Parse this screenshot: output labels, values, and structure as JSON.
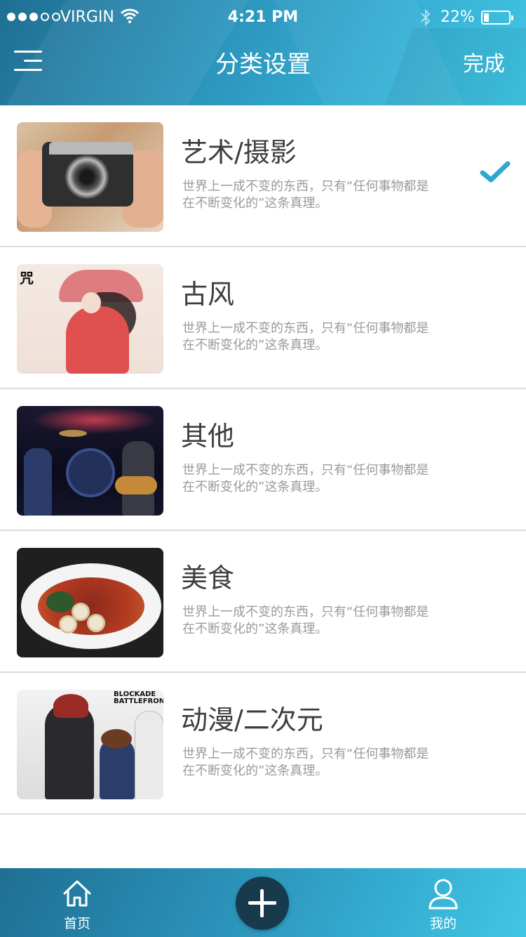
{
  "status_bar": {
    "carrier": "VIRGIN",
    "time": "4:21 PM",
    "battery": "22%",
    "battery_level": 0.22,
    "signal_bars_filled": 3,
    "signal_bars_total": 5
  },
  "nav": {
    "title": "分类设置",
    "done_label": "完成",
    "menu_icon": "hamburger-menu-icon"
  },
  "categories": [
    {
      "title": "艺术/摄影",
      "desc": "世界上一成不变的东西，只有“任何事物都是在不断变化的”这条真理。",
      "selected": true
    },
    {
      "title": "古风",
      "desc": "世界上一成不变的东西，只有“任何事物都是在不断变化的”这条真理。",
      "selected": false
    },
    {
      "title": "其他",
      "desc": "世界上一成不变的东西，只有“任何事物都是在不断变化的”这条真理。",
      "selected": false
    },
    {
      "title": "美食",
      "desc": "世界上一成不变的东西，只有“任何事物都是在不断变化的”这条真理。",
      "selected": false
    },
    {
      "title": "动漫/二次元",
      "desc": "世界上一成不变的东西，只有“任何事物都是在不断变化的”这条真理。",
      "selected": false
    }
  ],
  "thumb_text": {
    "ancient_seal": "咒",
    "anime_logo": "BLOCKADE BATTLEFRONT"
  },
  "tabbar": {
    "home_label": "首页",
    "me_label": "我的",
    "add_icon": "plus-icon"
  },
  "colors": {
    "accent": "#2fa8d0",
    "header_dark": "#1f6f93",
    "header_light": "#41c6e4",
    "check": "#2fa8d0",
    "title_text": "#3e3e3e",
    "desc_text": "#9a9a9a"
  }
}
